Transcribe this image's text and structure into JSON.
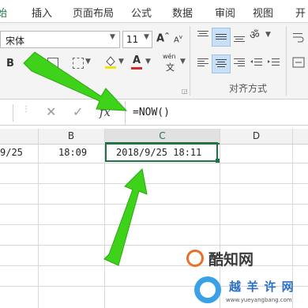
{
  "tabs": {
    "home": "始",
    "insert": "插入",
    "page_layout": "页面布局",
    "formulas": "公式",
    "data": "数据",
    "review": "审阅",
    "view": "视图",
    "extra": "开"
  },
  "font": {
    "name": "宋体",
    "size": "11"
  },
  "toolbar": {
    "bold": "B",
    "grow_font": "A",
    "shrink_font": "A",
    "font_color": "A",
    "wen_label": "wén",
    "wen_char": "文"
  },
  "alignment_group_label": "对齐方式",
  "formula": {
    "cancel": "✕",
    "confirm": "✓",
    "fx": "fx",
    "value": "=NOW()"
  },
  "columns": [
    "B",
    "C",
    "D"
  ],
  "cells": {
    "a1_partial": "9/25",
    "b1": "18:09",
    "c1": "2018/9/25 18:11"
  },
  "watermark": {
    "kuzhi": "酷知网",
    "yueyang": "越 羊 许 网",
    "url": "www.yueyangbang.com"
  },
  "colors": {
    "accent_green": "#217346",
    "arrow_green": "#3fd21b",
    "font_color_red": "#d62b2b"
  }
}
